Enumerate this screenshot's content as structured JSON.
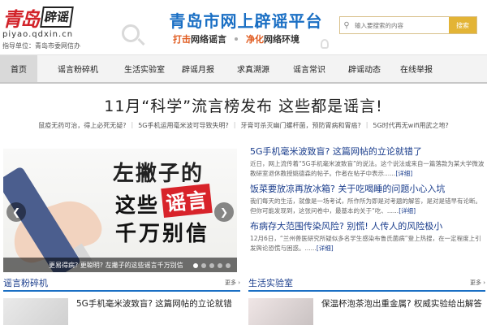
{
  "header": {
    "logo_text_red": "青岛",
    "logo_text_black": "辟谣",
    "domain": "piyao.qdxin.cn",
    "guide_unit": "指导单位：青岛市委网信办",
    "site_title": "青岛市网上辟谣平台",
    "slogan_1_hl": "打击",
    "slogan_1_rest": "网络谣言",
    "slogan_2_hl": "净化",
    "slogan_2_rest": "网络环境",
    "search_placeholder": "输入要搜索的内容",
    "search_button": "搜索"
  },
  "nav": {
    "items": [
      "首页",
      "谣言粉碎机",
      "生活实验室",
      "辟谣月报",
      "求真溯源",
      "谣言常识",
      "辟谣动态",
      "在线举报"
    ],
    "active_index": 0
  },
  "headline": {
    "title": "11月“科学”流言榜发布 这些都是谣言!",
    "links": [
      "鼠疫无药可治，得上必死无疑?",
      "5G手机运用毫米波可导致失明?",
      "牙膏可杀灭幽门螺杆菌，预防胃病和胃癌?",
      "5G时代再无wifi用武之地?"
    ]
  },
  "carousel": {
    "line1": "左撇子的",
    "line2a": "这些",
    "line2b": "谣言",
    "line3": "千万别信",
    "caption": "更易得病? 更聪明? 左撇子的这些谣言千万别信",
    "dots": 5,
    "active_dot": 0
  },
  "news": [
    {
      "title": "5G手机毫米波致盲? 这篇网帖的立论就错了",
      "summary": "近日，网上流传着“5G手机毫米波致盲”的说法。这个说法或来自一篇落款为某大学微波教研室退休教授姚德森的帖子。作者在帖子中表示......",
      "more": "[详细]"
    },
    {
      "title": "饭菜要放凉再放冰箱? 关于吃喝睡的问题小心入坑",
      "summary": "我们每天的生活，就像是一场考试，所作所为即是对考题的解答，是对是错早有论断。但你可能发现到，这张问卷中，最基本的关于“吃、......",
      "more": "[详细]"
    },
    {
      "title": "布病存大范围传染风险? 别慌! 人传人的风险极小",
      "summary": "12月6日，“兰州兽医研究所疑似多名学生感染布鲁氏菌病”登上热搜，在一定程度上引发舆论恐慌与困惑。......",
      "more": "[详细]"
    }
  ],
  "sections": [
    {
      "title": "谣言粉碎机",
      "more": "更多 ›",
      "first_item": "5G手机毫米波致盲? 这篇网帖的立论就错"
    },
    {
      "title": "生活实验室",
      "more": "更多 ›",
      "first_item": "保温杯泡茶泡出重金属? 权威实验给出解答"
    }
  ]
}
